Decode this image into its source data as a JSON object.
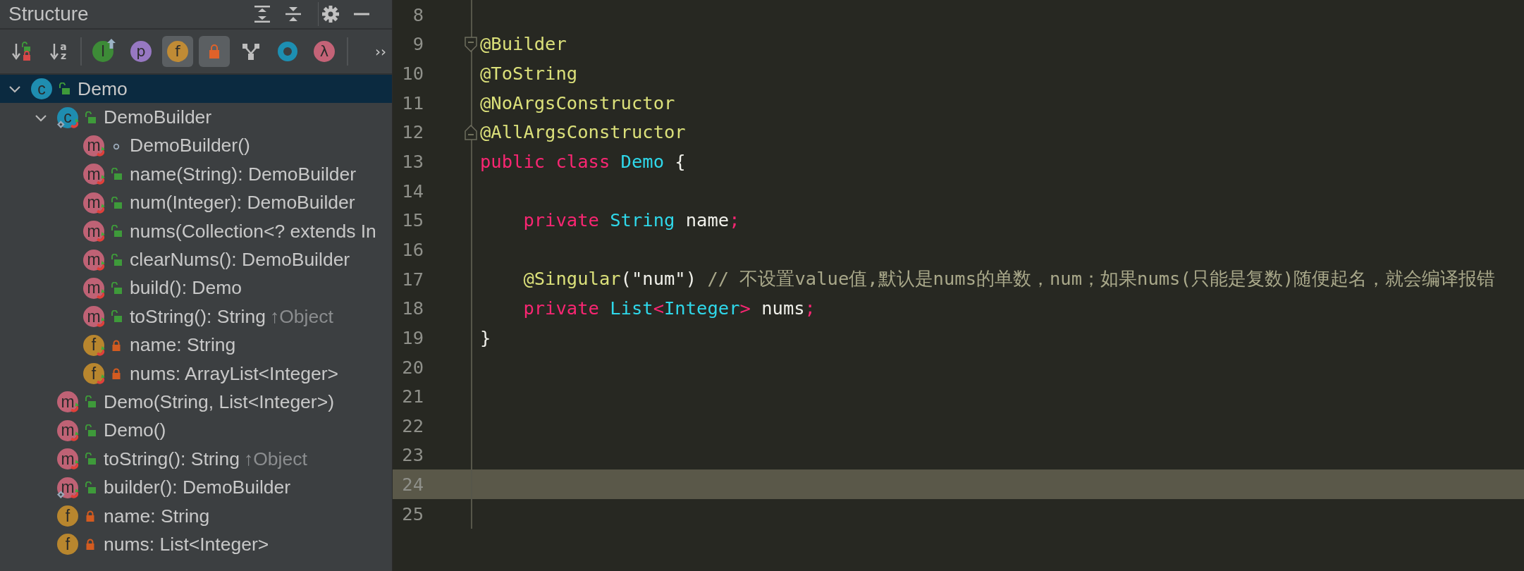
{
  "structure_panel": {
    "title": "Structure",
    "header_actions": [
      {
        "kind": "expand-all"
      },
      {
        "kind": "collapse-all"
      },
      {
        "kind": "settings"
      },
      {
        "kind": "minimize"
      }
    ],
    "toolbar_groups": [
      [
        {
          "kind": "sort-visibility",
          "selected": false
        },
        {
          "kind": "sort-alpha",
          "glyph": "az",
          "selected": false
        }
      ],
      [
        {
          "kind": "inherited",
          "glyph": "I",
          "selected": false
        },
        {
          "kind": "properties",
          "glyph": "p",
          "selected": false
        },
        {
          "kind": "fields",
          "glyph": "f",
          "selected": true
        },
        {
          "kind": "non-public",
          "selected": true
        },
        {
          "kind": "anonymous",
          "selected": false
        },
        {
          "kind": "ring",
          "selected": false
        },
        {
          "kind": "lambdas",
          "glyph": "λ",
          "selected": false
        }
      ],
      [
        {
          "kind": "more",
          "glyph": "››",
          "selected": false
        }
      ]
    ],
    "tree": [
      {
        "label": "Demo",
        "kind": "class",
        "letter": "c",
        "access": {
          "kind": "public"
        },
        "generated": false,
        "static": false,
        "expanded": true,
        "selected": true,
        "children": [
          {
            "label": "DemoBuilder",
            "kind": "class",
            "letter": "c",
            "access": {
              "kind": "public"
            },
            "generated": true,
            "static": true,
            "expanded": true,
            "selected": false,
            "children": [
              {
                "label": "DemoBuilder()",
                "kind": "method",
                "letter": "m",
                "access": {
                  "kind": "package"
                },
                "generated": true,
                "static": false,
                "selected": false
              },
              {
                "label": "name(String): DemoBuilder",
                "kind": "method",
                "letter": "m",
                "access": {
                  "kind": "public"
                },
                "generated": true,
                "static": false,
                "selected": false
              },
              {
                "label": "num(Integer): DemoBuilder",
                "kind": "method",
                "letter": "m",
                "access": {
                  "kind": "public"
                },
                "generated": true,
                "static": false,
                "selected": false
              },
              {
                "label": "nums(Collection<? extends In",
                "kind": "method",
                "letter": "m",
                "access": {
                  "kind": "public"
                },
                "generated": true,
                "static": false,
                "selected": false
              },
              {
                "label": "clearNums(): DemoBuilder",
                "kind": "method",
                "letter": "m",
                "access": {
                  "kind": "public"
                },
                "generated": true,
                "static": false,
                "selected": false
              },
              {
                "label": "build(): Demo",
                "kind": "method",
                "letter": "m",
                "access": {
                  "kind": "public"
                },
                "generated": true,
                "static": false,
                "selected": false
              },
              {
                "label": "toString(): String",
                "suffix": "↑Object",
                "kind": "method",
                "letter": "m",
                "access": {
                  "kind": "public"
                },
                "generated": true,
                "static": false,
                "selected": false
              },
              {
                "label": "name: String",
                "kind": "field",
                "letter": "f",
                "access": {
                  "kind": "private"
                },
                "generated": true,
                "static": false,
                "selected": false
              },
              {
                "label": "nums: ArrayList<Integer>",
                "kind": "field",
                "letter": "f",
                "access": {
                  "kind": "private"
                },
                "generated": true,
                "static": false,
                "selected": false
              }
            ]
          },
          {
            "label": "Demo(String, List<Integer>)",
            "kind": "method",
            "letter": "m",
            "access": {
              "kind": "public"
            },
            "generated": true,
            "static": false,
            "selected": false
          },
          {
            "label": "Demo()",
            "kind": "method",
            "letter": "m",
            "access": {
              "kind": "public"
            },
            "generated": true,
            "static": false,
            "selected": false
          },
          {
            "label": "toString(): String",
            "suffix": "↑Object",
            "kind": "method",
            "letter": "m",
            "access": {
              "kind": "public"
            },
            "generated": true,
            "static": false,
            "selected": false
          },
          {
            "label": "builder(): DemoBuilder",
            "kind": "method",
            "letter": "m",
            "access": {
              "kind": "public"
            },
            "generated": true,
            "static": true,
            "selected": false
          },
          {
            "label": "name: String",
            "kind": "field",
            "letter": "f",
            "access": {
              "kind": "private"
            },
            "generated": false,
            "static": false,
            "selected": false
          },
          {
            "label": "nums: List<Integer>",
            "kind": "field",
            "letter": "f",
            "access": {
              "kind": "private"
            },
            "generated": false,
            "static": false,
            "selected": false
          }
        ]
      }
    ]
  },
  "editor": {
    "lines": [
      {
        "number": "8",
        "current": false
      },
      {
        "number": "9",
        "current": false,
        "fold": {
          "kind": "start"
        },
        "tokens": [
          {
            "text": "@Builder",
            "kind": "annotation"
          }
        ]
      },
      {
        "number": "10",
        "current": false,
        "tokens": [
          {
            "text": "@ToString",
            "kind": "annotation"
          }
        ]
      },
      {
        "number": "11",
        "current": false,
        "tokens": [
          {
            "text": "@NoArgsConstructor",
            "kind": "annotation"
          }
        ]
      },
      {
        "number": "12",
        "current": false,
        "fold": {
          "kind": "end"
        },
        "tokens": [
          {
            "text": "@AllArgsConstructor",
            "kind": "annotation"
          }
        ]
      },
      {
        "number": "13",
        "current": false,
        "tokens": [
          {
            "text": "public class ",
            "kind": "keyword"
          },
          {
            "text": "Demo",
            "kind": "type"
          },
          {
            "text": " {",
            "kind": "plain"
          }
        ]
      },
      {
        "number": "14",
        "current": false
      },
      {
        "number": "15",
        "current": false,
        "tokens": [
          {
            "text": "    private ",
            "kind": "keyword"
          },
          {
            "text": "String",
            "kind": "type"
          },
          {
            "text": " name",
            "kind": "plain"
          },
          {
            "text": ";",
            "kind": "keyword"
          }
        ]
      },
      {
        "number": "16",
        "current": false
      },
      {
        "number": "17",
        "current": false,
        "tokens": [
          {
            "text": "    @Singular",
            "kind": "annotation"
          },
          {
            "text": "(\"num\") ",
            "kind": "plain"
          },
          {
            "text": "// 不设置value值,默认是nums的单数，num；如果nums(只能是复数)随便起名，就会编译报错",
            "kind": "comment"
          }
        ]
      },
      {
        "number": "18",
        "current": false,
        "tokens": [
          {
            "text": "    private ",
            "kind": "keyword"
          },
          {
            "text": "List",
            "kind": "type"
          },
          {
            "text": "<",
            "kind": "keyword"
          },
          {
            "text": "Integer",
            "kind": "type"
          },
          {
            "text": ">",
            "kind": "keyword"
          },
          {
            "text": " nums",
            "kind": "plain"
          },
          {
            "text": ";",
            "kind": "keyword"
          }
        ]
      },
      {
        "number": "19",
        "current": false,
        "tokens": [
          {
            "text": "}",
            "kind": "plain"
          }
        ]
      },
      {
        "number": "20",
        "current": false
      },
      {
        "number": "21",
        "current": false
      },
      {
        "number": "22",
        "current": false
      },
      {
        "number": "23",
        "current": false
      },
      {
        "number": "24",
        "current": true
      },
      {
        "number": "25",
        "current": false
      }
    ]
  }
}
